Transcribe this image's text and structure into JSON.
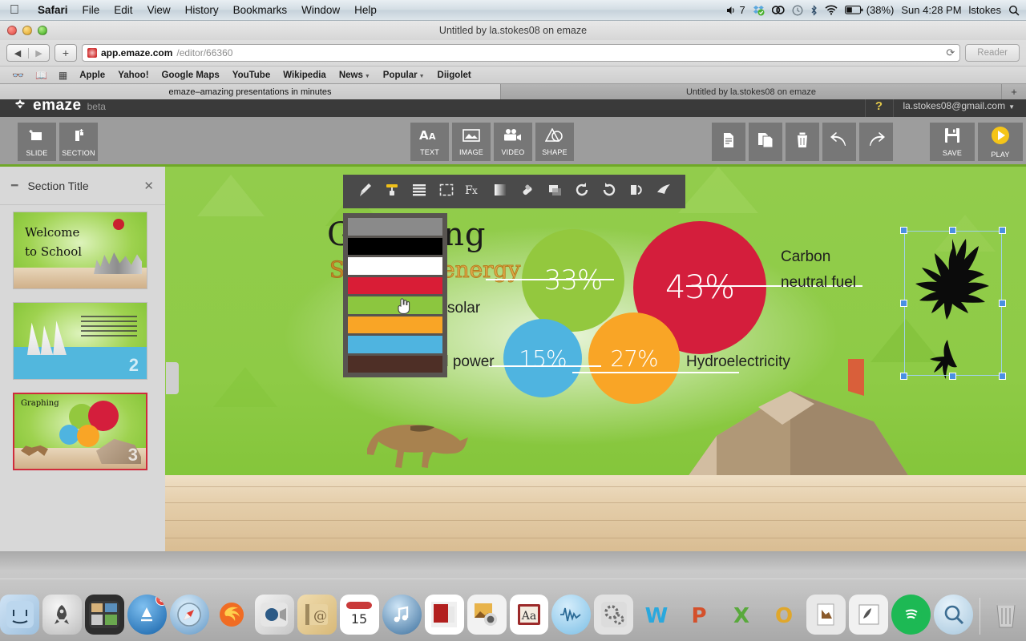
{
  "menubar": {
    "apple_icon": "apple-icon",
    "items": [
      {
        "label": "Safari",
        "bold": true
      },
      {
        "label": "File",
        "bold": false
      },
      {
        "label": "Edit",
        "bold": false
      },
      {
        "label": "View",
        "bold": false
      },
      {
        "label": "History",
        "bold": false
      },
      {
        "label": "Bookmarks",
        "bold": false
      },
      {
        "label": "Window",
        "bold": false
      },
      {
        "label": "Help",
        "bold": false
      }
    ],
    "status": {
      "volume_icon": "volume-icon",
      "volume_value": "7",
      "dropbox_icon": "dropbox-icon",
      "creative_cloud_icon": "creative-cloud-icon",
      "timemachine_icon": "clock-icon",
      "bluetooth_icon": "bluetooth-icon",
      "wifi_icon": "wifi-icon",
      "battery_icon": "battery-icon",
      "battery_pct": "(38%)",
      "clock": "Sun 4:28 PM",
      "user": "lstokes",
      "spotlight_icon": "search-icon"
    }
  },
  "safari": {
    "window_title": "Untitled by la.stokes08 on emaze",
    "back_icon": "back-arrow-icon",
    "forward_icon": "forward-arrow-icon",
    "new_tab_icon": "plus-icon",
    "url_strong": "app.emaze.com",
    "url_dim": "/editor/66360",
    "reload_icon": "reload-icon",
    "reader_label": "Reader",
    "bookmarks_icons": [
      "glasses-icon",
      "book-icon",
      "grid-icon"
    ],
    "bookmarks": [
      {
        "label": "Apple",
        "caret": false
      },
      {
        "label": "Yahoo!",
        "caret": false
      },
      {
        "label": "Google Maps",
        "caret": false
      },
      {
        "label": "YouTube",
        "caret": false
      },
      {
        "label": "Wikipedia",
        "caret": false
      },
      {
        "label": "News",
        "caret": true
      },
      {
        "label": "Popular",
        "caret": true
      },
      {
        "label": "Diigolet",
        "caret": false
      }
    ],
    "tabs": [
      {
        "label": "emaze–amazing presentations in minutes",
        "active": true
      },
      {
        "label": "Untitled by la.stokes08 on emaze",
        "active": false
      }
    ],
    "tab_plus": "+"
  },
  "emaze": {
    "logo_mark": "emaze-logo-icon",
    "logo_word": "emaze",
    "beta_label": "beta",
    "help_label": "?",
    "account": "la.stokes08@gmail.com",
    "account_caret": "▾",
    "toolbar_left": [
      {
        "label": "SLIDE",
        "icon": "add-slide-icon"
      },
      {
        "label": "SECTION",
        "icon": "add-section-icon"
      }
    ],
    "toolbar_center": [
      {
        "label": "TEXT",
        "icon": "text-icon"
      },
      {
        "label": "IMAGE",
        "icon": "image-icon"
      },
      {
        "label": "VIDEO",
        "icon": "video-icon"
      },
      {
        "label": "SHAPE",
        "icon": "shape-icon"
      }
    ],
    "toolbar_actions": [
      {
        "icon": "copy-icon",
        "label": ""
      },
      {
        "icon": "duplicate-icon",
        "label": ""
      },
      {
        "icon": "trash-icon",
        "label": ""
      },
      {
        "icon": "undo-icon",
        "label": ""
      },
      {
        "icon": "redo-icon",
        "label": ""
      }
    ],
    "toolbar_right": [
      {
        "label": "SAVE",
        "icon": "floppy-disk-icon"
      },
      {
        "label": "PLAY",
        "icon": "play-icon"
      }
    ]
  },
  "panel": {
    "collapse_icon": "minus-icon",
    "title": "Section Title",
    "close_icon": "close-icon",
    "slides": [
      {
        "index": "1",
        "title_line1": "Welcome",
        "title_line2": "to School",
        "selected": false
      },
      {
        "index": "2",
        "title_line1": "",
        "title_line2": "",
        "selected": false
      },
      {
        "index": "3",
        "title_line1": "Graphing",
        "title_line2": "",
        "selected": true
      }
    ]
  },
  "float_toolbar": {
    "icons": [
      "brush-icon",
      "paint-roller-icon",
      "lines-icon",
      "crop-icon",
      "effects-fx-icon",
      "gradient-icon",
      "eraser-icon",
      "shadow-icon",
      "rotate-right-icon",
      "rotate-left-icon",
      "flip-icon",
      "ink-icon"
    ]
  },
  "color_palette": {
    "swatches": [
      {
        "name": "transparent",
        "hex": "#8a8a8a"
      },
      {
        "name": "black",
        "hex": "#000000"
      },
      {
        "name": "white",
        "hex": "#ffffff"
      },
      {
        "name": "red",
        "hex": "#d91d36"
      },
      {
        "name": "green",
        "hex": "#8cc63f"
      },
      {
        "name": "orange",
        "hex": "#f9a526"
      },
      {
        "name": "blue",
        "hex": "#4fb4e0"
      },
      {
        "name": "brown",
        "hex": "#4e2f26"
      }
    ],
    "hovered_index": 4,
    "cursor_icon": "pointing-hand-cursor"
  },
  "slide": {
    "title": "Graphing",
    "subtitle_left": "S",
    "subtitle_right": "energy",
    "eagle_icon": "eagle-silhouette",
    "dog_icon": "dog-silhouette",
    "house_icon": "polygon-house",
    "labels": {
      "solar": "solar",
      "wind": "d power",
      "hydro": "Hydroelectricity",
      "carbon_line1": "Carbon",
      "carbon_line2": "neutral fuel"
    }
  },
  "chart_data": {
    "type": "pie",
    "title": "Graphing",
    "categories": [
      "Solar",
      "Carbon neutral fuel",
      "Hydroelectricity",
      "Wind power"
    ],
    "values": [
      33,
      43,
      27,
      15
    ],
    "labels": [
      "33%",
      "43%",
      "27%",
      "15%"
    ],
    "colors": [
      "#93c83e",
      "#d41e3c",
      "#f9a526",
      "#4fb4e0"
    ],
    "legend_position": "inline",
    "annotations": [
      "solar",
      "Carbon neutral fuel",
      "Hydroelectricity",
      "d power"
    ]
  },
  "dock": {
    "items": [
      {
        "name": "finder",
        "icon": "finder-icon",
        "badge": ""
      },
      {
        "name": "launchpad",
        "icon": "rocket-icon",
        "badge": ""
      },
      {
        "name": "mission-control",
        "icon": "mission-control-icon",
        "badge": ""
      },
      {
        "name": "app-store",
        "icon": "app-store-icon",
        "badge": "3"
      },
      {
        "name": "safari",
        "icon": "compass-icon",
        "badge": ""
      },
      {
        "name": "firefox",
        "icon": "firefox-icon",
        "badge": ""
      },
      {
        "name": "facetime",
        "icon": "facetime-icon",
        "badge": ""
      },
      {
        "name": "mail",
        "icon": "mail-at-icon",
        "badge": ""
      },
      {
        "name": "calendar",
        "icon": "calendar-icon",
        "badge": "15"
      },
      {
        "name": "itunes",
        "icon": "music-note-icon",
        "badge": ""
      },
      {
        "name": "imovie",
        "icon": "imovie-icon",
        "badge": ""
      },
      {
        "name": "iphoto",
        "icon": "camera-icon",
        "badge": ""
      },
      {
        "name": "dictionary",
        "icon": "book-aa-icon",
        "badge": ""
      },
      {
        "name": "audacity",
        "icon": "waveform-icon",
        "badge": ""
      },
      {
        "name": "system-preferences",
        "icon": "gears-icon",
        "badge": ""
      },
      {
        "name": "word",
        "icon": "word-w-icon",
        "badge": ""
      },
      {
        "name": "powerpoint",
        "icon": "powerpoint-p-icon",
        "badge": ""
      },
      {
        "name": "excel",
        "icon": "excel-x-icon",
        "badge": ""
      },
      {
        "name": "outlook",
        "icon": "outlook-o-icon",
        "badge": ""
      },
      {
        "name": "preview",
        "icon": "preview-icon",
        "badge": ""
      },
      {
        "name": "stamp-mail",
        "icon": "stamp-icon",
        "badge": ""
      },
      {
        "name": "spotify",
        "icon": "spotify-icon",
        "badge": ""
      },
      {
        "name": "search",
        "icon": "magnifier-icon",
        "badge": ""
      },
      {
        "name": "trash",
        "icon": "trash-bin-icon",
        "badge": ""
      }
    ]
  }
}
